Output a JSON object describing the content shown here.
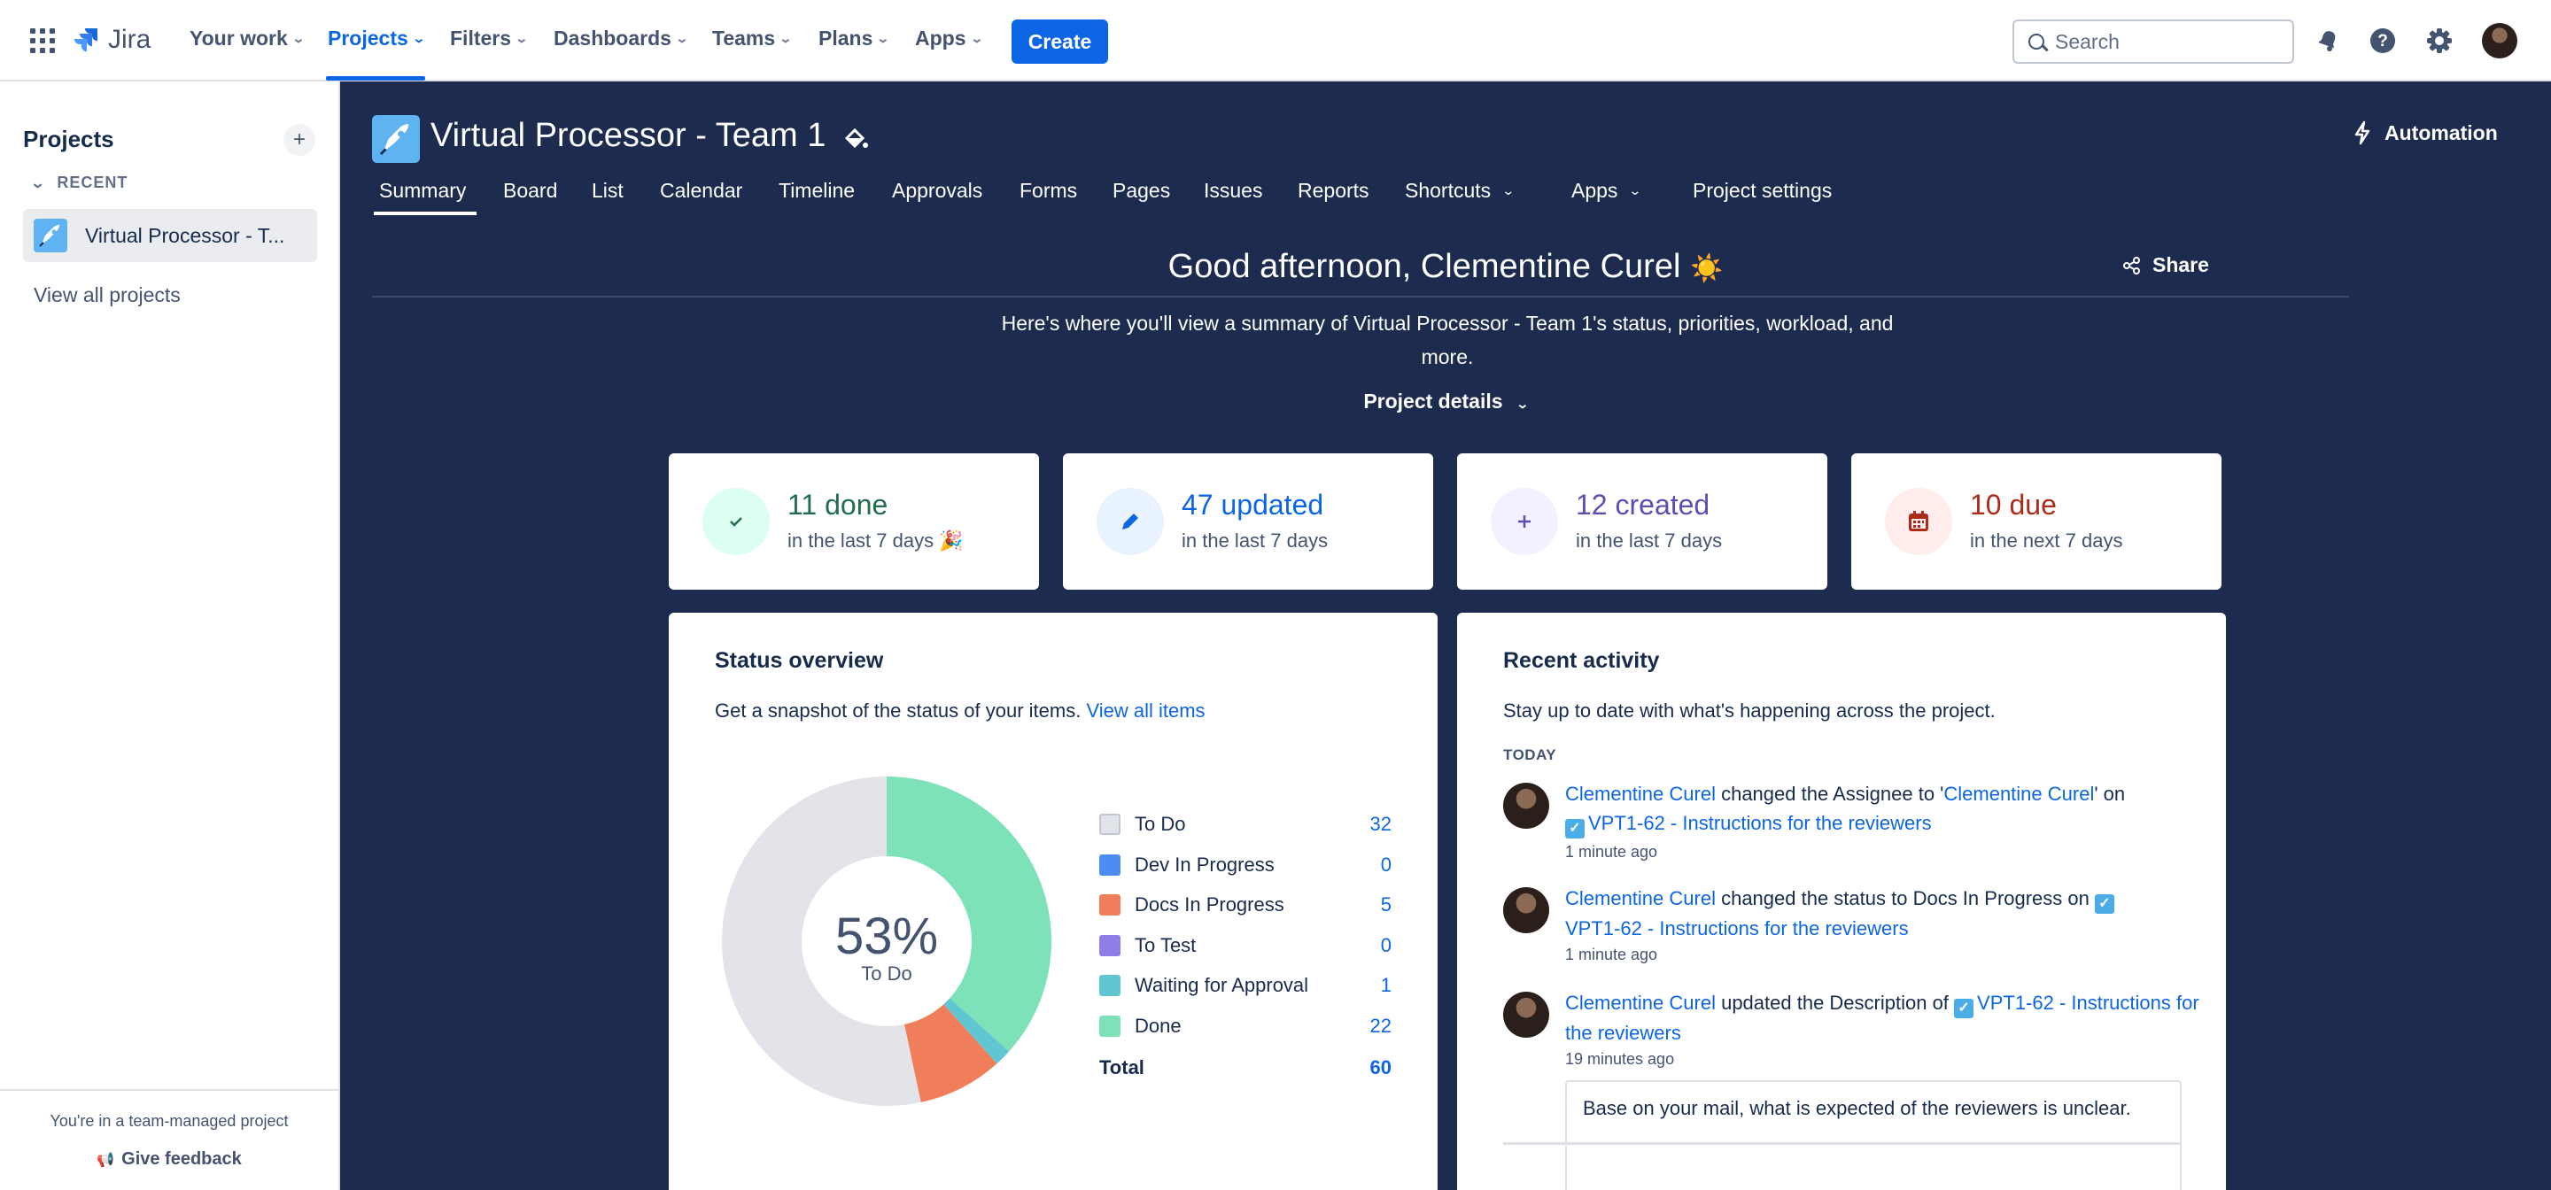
{
  "topnav": {
    "logo_text": "Jira",
    "items": [
      {
        "label": "Your work"
      },
      {
        "label": "Projects"
      },
      {
        "label": "Filters"
      },
      {
        "label": "Dashboards"
      },
      {
        "label": "Teams"
      },
      {
        "label": "Plans"
      },
      {
        "label": "Apps"
      }
    ],
    "create_label": "Create",
    "search_placeholder": "Search",
    "accent_color": "#0c66e4"
  },
  "sidebar": {
    "title": "Projects",
    "recent_label": "RECENT",
    "recent_project": "Virtual Processor - T...",
    "view_all": "View all projects",
    "team_note": "You're in a team-managed project",
    "feedback": "Give feedback"
  },
  "project": {
    "title": "Virtual Processor - Team 1",
    "automation": "Automation",
    "tabs": [
      {
        "label": "Summary"
      },
      {
        "label": "Board"
      },
      {
        "label": "List"
      },
      {
        "label": "Calendar"
      },
      {
        "label": "Timeline"
      },
      {
        "label": "Approvals"
      },
      {
        "label": "Forms"
      },
      {
        "label": "Pages"
      },
      {
        "label": "Issues"
      },
      {
        "label": "Reports"
      },
      {
        "label": "Shortcuts"
      },
      {
        "label": "Apps"
      },
      {
        "label": "Project settings"
      }
    ]
  },
  "summary": {
    "greeting": "Good afternoon, Clementine Curel",
    "greeting_emoji": "☀️",
    "share": "Share",
    "description": "Here's where you'll view a summary of Virtual Processor - Team 1's status, priorities, workload, and more.",
    "project_details": "Project details"
  },
  "stats": [
    {
      "big": "11 done",
      "small": "in the last 7 days 🎉",
      "color": "#216e4e",
      "bg": "#dcfff1",
      "icon": "check-icon"
    },
    {
      "big": "47 updated",
      "small": "in the last 7 days",
      "color": "#0c66e4",
      "bg": "#e9f2ff",
      "icon": "pencil-icon"
    },
    {
      "big": "12 created",
      "small": "in the last 7 days",
      "color": "#5e4db2",
      "bg": "#f3f0ff",
      "icon": "plus-icon"
    },
    {
      "big": "10 due",
      "small": "in the next 7 days",
      "color": "#ae2a19",
      "bg": "#ffedeb",
      "icon": "calendar-icon"
    }
  ],
  "status_overview": {
    "title": "Status overview",
    "desc": "Get a snapshot of the status of your items.",
    "link": "View all items",
    "center_percent": "53%",
    "center_label": "To Do",
    "total_label": "Total",
    "total_value": "60"
  },
  "chart_data": {
    "type": "pie",
    "categories": [
      "To Do",
      "Dev In Progress",
      "Docs In Progress",
      "To Test",
      "Waiting for Approval",
      "Done"
    ],
    "values": [
      32,
      0,
      5,
      0,
      1,
      22
    ],
    "colors": [
      "#e2e4e9",
      "#4c8cf5",
      "#f07e5a",
      "#8f7ee7",
      "#60c6d2",
      "#7ee2b8"
    ]
  },
  "recent_activity": {
    "title": "Recent activity",
    "desc": "Stay up to date with what's happening across the project.",
    "today": "TODAY",
    "items": [
      {
        "user": "Clementine Curel",
        "text1": " changed the Assignee to '",
        "target": "Clementine Curel",
        "text2": "' on",
        "issue": "VPT1-62 - Instructions for the reviewers",
        "time": "1 minute ago"
      },
      {
        "user": "Clementine Curel",
        "text1": " changed the status to Docs In Progress on ",
        "issue": "VPT1-62 - Instructions for the reviewers",
        "time": "1 minute ago"
      },
      {
        "user": "Clementine Curel",
        "text1": " updated the Description of ",
        "issue": "VPT1-62 - Instructions for the reviewers",
        "time": "19 minutes ago"
      }
    ],
    "description_preview": "Base on your mail, what is expected of the reviewers is unclear."
  }
}
